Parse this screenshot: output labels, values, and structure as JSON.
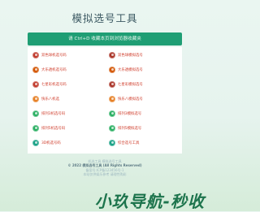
{
  "page": {
    "title": "模拟选号工具"
  },
  "banner": {
    "text": "请 Ctrl+D 收藏本页到浏览器收藏夹"
  },
  "tools": {
    "left": [
      {
        "label": "双色球机选号码",
        "color": "#c0392b"
      },
      {
        "label": "大乐透机选号码",
        "color": "#d35400"
      },
      {
        "label": "七星彩机选号码",
        "color": "#c0392b"
      },
      {
        "label": "快乐八机选",
        "color": "#e67e22"
      },
      {
        "label": "排列3机选号码",
        "color": "#27ae60"
      },
      {
        "label": "排列5机选号码",
        "color": "#27ae60"
      },
      {
        "label": "3D机选号码",
        "color": "#16a085"
      }
    ],
    "right": [
      {
        "label": "双色球模拟选号",
        "color": "#a93226"
      },
      {
        "label": "大乐透模拟选号",
        "color": "#d35400"
      },
      {
        "label": "七星彩模拟选号",
        "color": "#a93226"
      },
      {
        "label": "快乐八模拟选号",
        "color": "#e67e22"
      },
      {
        "label": "排列3模拟选号",
        "color": "#27ae60"
      },
      {
        "label": "排列5模拟选号",
        "color": "#27ae60"
      },
      {
        "label": "综合选号工具",
        "color": "#16a085"
      }
    ]
  },
  "footer": {
    "line1": "机选工具 模拟选号工具",
    "line2": "© 2022 模拟选号工具 (All Rights Reserved)",
    "line3": "备案号:ICP备123456号-1",
    "line4": "本站仅供娱乐参考 请理性购彩"
  },
  "watermark": {
    "text": "小玖导航-秒收"
  }
}
